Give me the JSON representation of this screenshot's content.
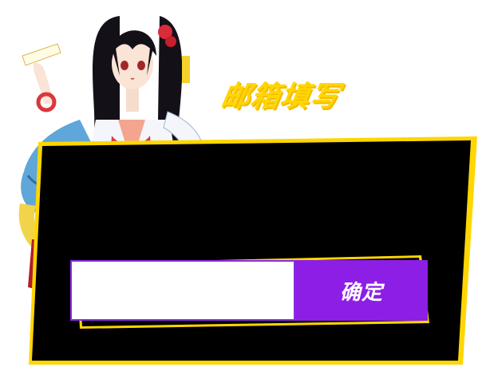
{
  "dialog": {
    "title": "邮箱填写",
    "email_input": {
      "value": "",
      "placeholder": ""
    },
    "confirm_label": "确定"
  },
  "colors": {
    "accent_yellow": "#ffd600",
    "panel_black": "#000000",
    "button_purple": "#8d1ee6",
    "input_border": "#8b2be2"
  },
  "icons": {
    "character": "anime-girl-illustration"
  }
}
